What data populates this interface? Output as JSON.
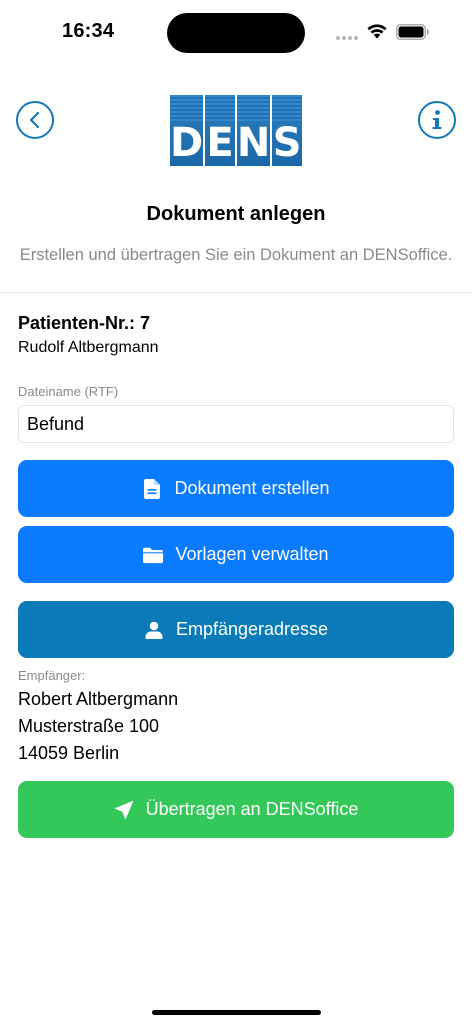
{
  "status_bar": {
    "time": "16:34"
  },
  "header": {
    "logo_letters": [
      "D",
      "E",
      "N",
      "S"
    ],
    "back_icon": "chevron-left-icon",
    "info_icon": "info-icon",
    "accent_color": "#1479b8"
  },
  "page": {
    "title": "Dokument anlegen",
    "subtitle": "Erstellen und übertragen Sie ein Dokument an DENSoffice."
  },
  "patient": {
    "number_label": "Patienten-Nr.: 7",
    "name": "Rudolf Altbergmann"
  },
  "filename_field": {
    "label": "Dateiname (RTF)",
    "value": "Befund"
  },
  "buttons": {
    "create_document": "Dokument erstellen",
    "manage_templates": "Vorlagen verwalten",
    "recipient_address": "Empfängeradresse",
    "transfer": "Übertragen an DENSoffice"
  },
  "recipient": {
    "label": "Empfänger:",
    "lines": [
      "Robert Altbergmann",
      "Musterstraße 100",
      "14059 Berlin"
    ]
  },
  "colors": {
    "primary_blue": "#0a7aff",
    "teal": "#0a7bb8",
    "green": "#34c759",
    "secondary_text": "#8a8a8e"
  }
}
